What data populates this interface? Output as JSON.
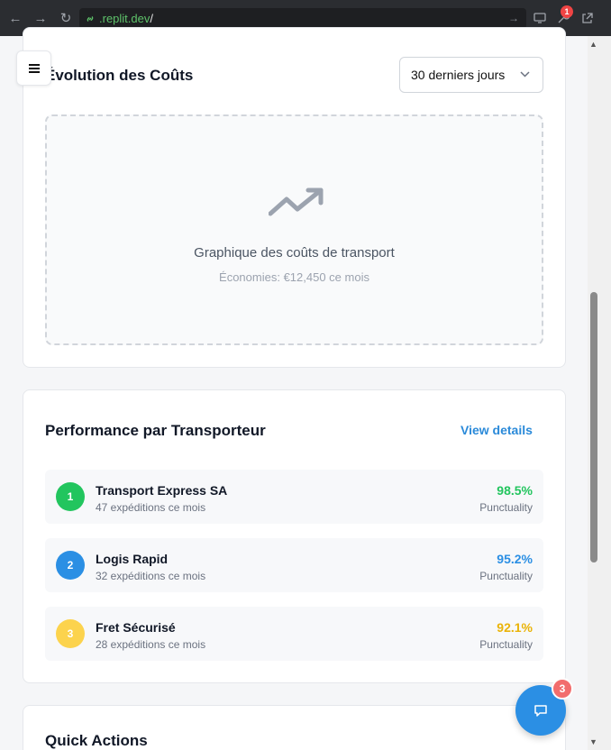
{
  "browser": {
    "url_domain": ".replit.dev",
    "url_slash": "/",
    "notification_count": "1"
  },
  "costs_card": {
    "title": "Évolution des Coûts",
    "period_select": "30 derniers jours",
    "chart_placeholder_title": "Graphique des coûts de transport",
    "chart_placeholder_subtitle": "Économies: €12,450 ce mois"
  },
  "performance_card": {
    "title": "Performance par Transporteur",
    "view_details": "View details",
    "carriers": [
      {
        "rank": "1",
        "name": "Transport Express SA",
        "shipments": "47 expéditions ce mois",
        "percent": "98.5%",
        "metric": "Punctuality",
        "color": "#22c55e"
      },
      {
        "rank": "2",
        "name": "Logis Rapid",
        "shipments": "32 expéditions ce mois",
        "percent": "95.2%",
        "metric": "Punctuality",
        "color": "#2b8fe4"
      },
      {
        "rank": "3",
        "name": "Fret Sécurisé",
        "shipments": "28 expéditions ce mois",
        "percent": "92.1%",
        "metric": "Punctuality",
        "color": "#fcd34d"
      }
    ]
  },
  "quick_actions": {
    "title": "Quick Actions"
  },
  "chat": {
    "badge_count": "3"
  },
  "icons": [
    "back-arrow-icon",
    "forward-arrow-icon",
    "reload-icon",
    "link-icon",
    "monitor-icon",
    "wrench-icon",
    "external-link-icon",
    "hamburger-menu-icon",
    "chevron-down-icon",
    "trending-up-icon",
    "chat-icon"
  ]
}
